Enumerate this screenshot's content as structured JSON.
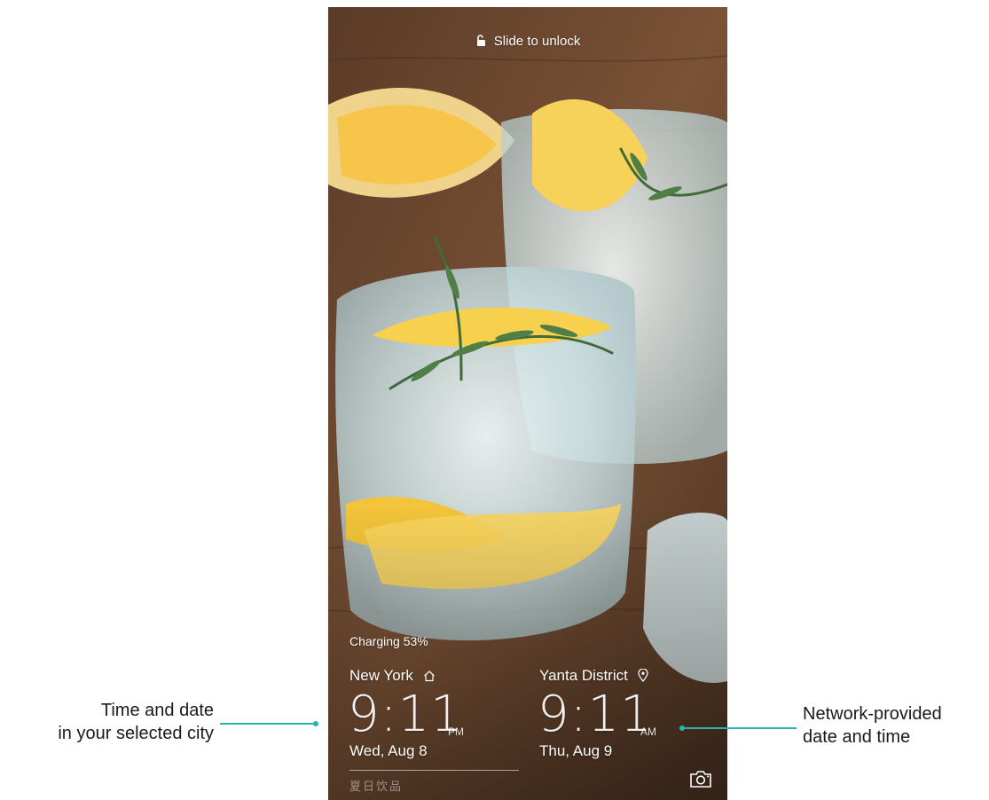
{
  "lockscreen": {
    "unlock_hint": "Slide to unlock",
    "charging": "Charging 53%",
    "home_city": {
      "name": "New York",
      "time": "9:11",
      "ampm": "PM",
      "date": "Wed, Aug 8",
      "icon": "home-icon"
    },
    "local_city": {
      "name": "Yanta District",
      "time": "9:11",
      "ampm": "AM",
      "date": "Thu, Aug 9",
      "icon": "location-pin-icon"
    },
    "magazine_title": "夏日饮品",
    "camera_icon": "camera-icon"
  },
  "callouts": {
    "left_line1": "Time and date",
    "left_line2": "in your selected city",
    "right_line1": "Network-provided",
    "right_line2": "date and time",
    "line_color": "#2ab3b0"
  }
}
